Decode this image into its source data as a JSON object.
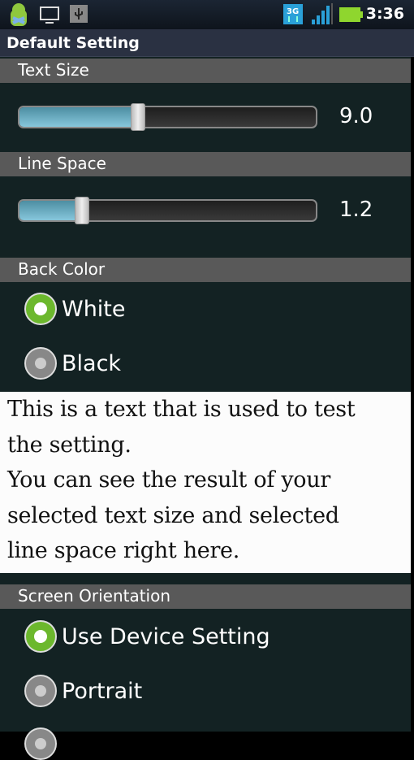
{
  "status_bar": {
    "time": "3:36",
    "network": "3G",
    "icons": [
      "android-notification-icon",
      "monitor-icon",
      "usb-icon",
      "3g-icon",
      "signal-icon",
      "battery-icon"
    ],
    "battery_color": "#8fd62e"
  },
  "title": "Default Setting",
  "text_size": {
    "label": "Text Size",
    "value": "9.0",
    "fraction": 0.4
  },
  "line_space": {
    "label": "Line Space",
    "value": "1.2",
    "fraction": 0.21
  },
  "back_color": {
    "label": "Back Color",
    "options": [
      {
        "label": "White",
        "selected": true
      },
      {
        "label": "Black",
        "selected": false
      }
    ]
  },
  "preview": {
    "lines": [
      "This is a text that is used to test",
      "the setting.",
      "You can see the result of your",
      "selected text size and selected",
      "line space right here."
    ]
  },
  "screen_orientation": {
    "label": "Screen Orientation",
    "options": [
      {
        "label": "Use Device Setting",
        "selected": true
      },
      {
        "label": "Portrait",
        "selected": false
      }
    ]
  },
  "colors": {
    "accent": "#6cb82d",
    "slider_fill": "#87c7dc",
    "header_bg": "#595959",
    "background": "#132223"
  }
}
